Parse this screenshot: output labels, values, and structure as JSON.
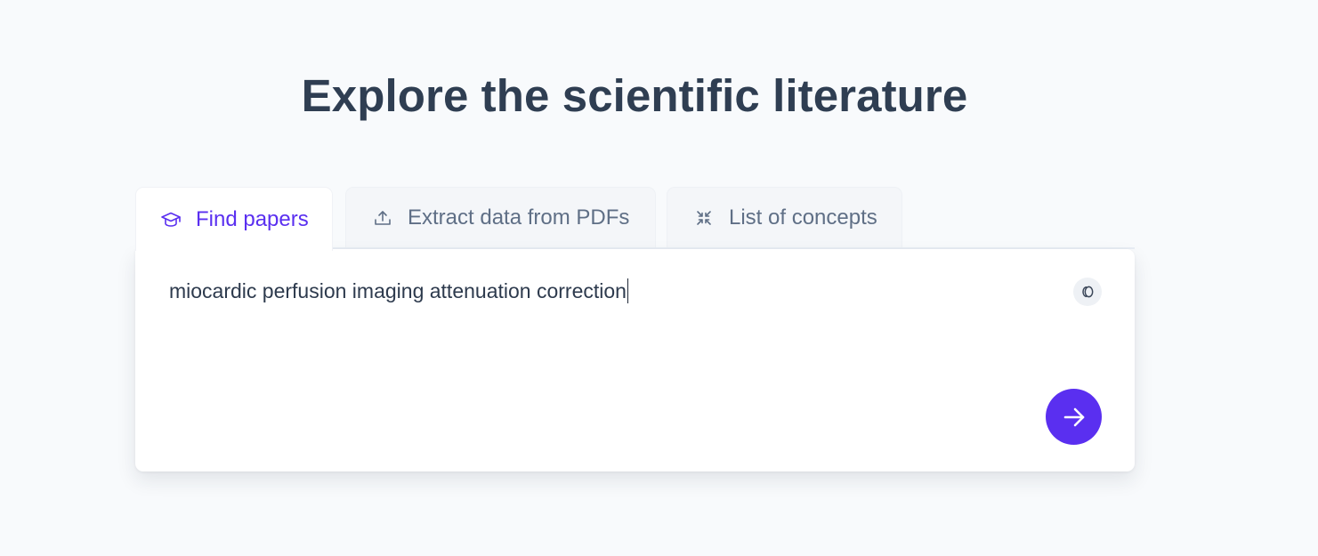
{
  "page": {
    "title": "Explore the scientific literature"
  },
  "tabs": [
    {
      "label": "Find papers",
      "icon": "graduation-cap-icon",
      "active": true
    },
    {
      "label": "Extract data from PDFs",
      "icon": "upload-icon",
      "active": false
    },
    {
      "label": "List of concepts",
      "icon": "collapse-arrows-icon",
      "active": false
    }
  ],
  "search": {
    "query": "miocardic perfusion imaging attenuation correction",
    "corner_button_icon": "coins-icon",
    "submit_icon": "arrow-right-icon"
  },
  "colors": {
    "accent": "#5a2ff0",
    "background": "#f8fafc",
    "heading": "#2f3e52",
    "muted_tab_text": "#5f6f86"
  }
}
